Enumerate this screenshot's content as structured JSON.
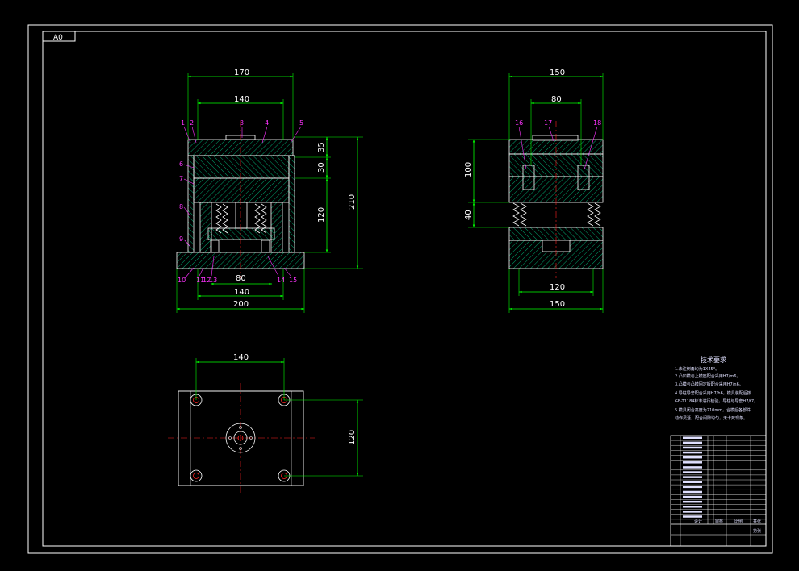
{
  "sheet_size": "A0",
  "colors": {
    "background": "#000000",
    "frame": "#ffffff",
    "dimension": "#00ff00",
    "hatch": "#00cc88",
    "centerline": "#ff2222",
    "part_label": "#ff33ff",
    "spring": "#ffffff",
    "notes": "#e0e0ff"
  },
  "front_view": {
    "dims_top": [
      "170",
      "140"
    ],
    "dims_right": [
      "35",
      "30",
      "120",
      "210"
    ],
    "dims_bottom": [
      "80",
      "140",
      "200"
    ],
    "part_labels_top": [
      "1",
      "2",
      "3",
      "4",
      "5"
    ],
    "part_labels_left": [
      "6",
      "7",
      "8",
      "9"
    ],
    "part_labels_bottom": [
      "10",
      "11",
      "12",
      "13",
      "14",
      "15"
    ]
  },
  "side_view": {
    "dims_top": [
      "150",
      "80"
    ],
    "dims_left": [
      "100",
      "40"
    ],
    "dims_bottom": [
      "120",
      "150"
    ],
    "part_labels": [
      "16",
      "17",
      "18"
    ]
  },
  "plan_view": {
    "dim_top": "140",
    "dim_right": "120"
  },
  "notes": {
    "title": "技术要求",
    "lines": [
      "1.未注倒角均为1X45°。",
      "2.凸凹模与上模座配合采用H7/m6。",
      "3.凸模与凸模固定板配合采用H7/n6。",
      "4.导柱导套配合采用H7/h6，模具装配后按",
      "  GB-T1184标准进行检验。导柱与导套H7/f7。",
      "5.模具闭合高度为210mm，合模后各部件",
      "  动作灵活，配合间隙均匀，无卡死现象。"
    ]
  },
  "title_block": {
    "rows": 18,
    "bottom_labels": [
      "设计",
      "审核",
      "比例",
      "共张",
      "第张"
    ]
  }
}
